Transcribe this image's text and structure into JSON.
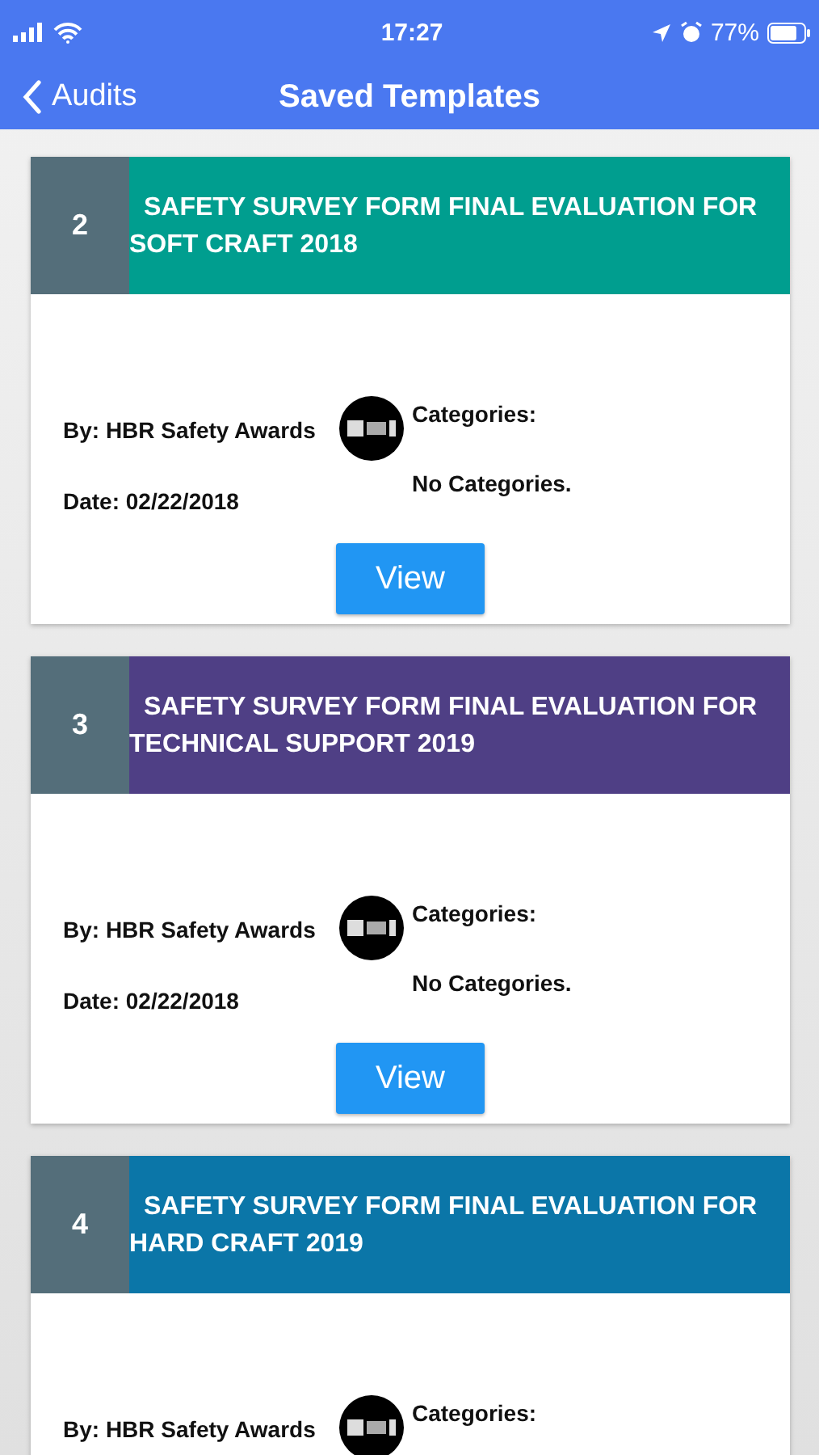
{
  "status_bar": {
    "time": "17:27",
    "battery": "77%"
  },
  "nav": {
    "back": "Audits",
    "title": "Saved Templates"
  },
  "templates": [
    {
      "number": "2",
      "title": "SAFETY SURVEY FORM FINAL EVALUATION FOR SOFT CRAFT 2018",
      "color": "#009e8f",
      "author": "By: HBR Safety Awards",
      "date": "Date: 02/22/2018",
      "categories_label": "Categories:",
      "categories": "No Categories.",
      "button": "View"
    },
    {
      "number": "3",
      "title": "SAFETY SURVEY FORM FINAL EVALUATION FOR TECHNICAL SUPPORT 2019",
      "color": "#4f3f85",
      "author": "By: HBR Safety Awards",
      "date": "Date: 02/22/2018",
      "categories_label": "Categories:",
      "categories": "No Categories.",
      "button": "View"
    },
    {
      "number": "4",
      "title": "SAFETY SURVEY FORM FINAL EVALUATION FOR HARD CRAFT 2019",
      "color": "#0b76a8",
      "author": "By: HBR Safety Awards",
      "categories_label": "Categories:"
    }
  ]
}
